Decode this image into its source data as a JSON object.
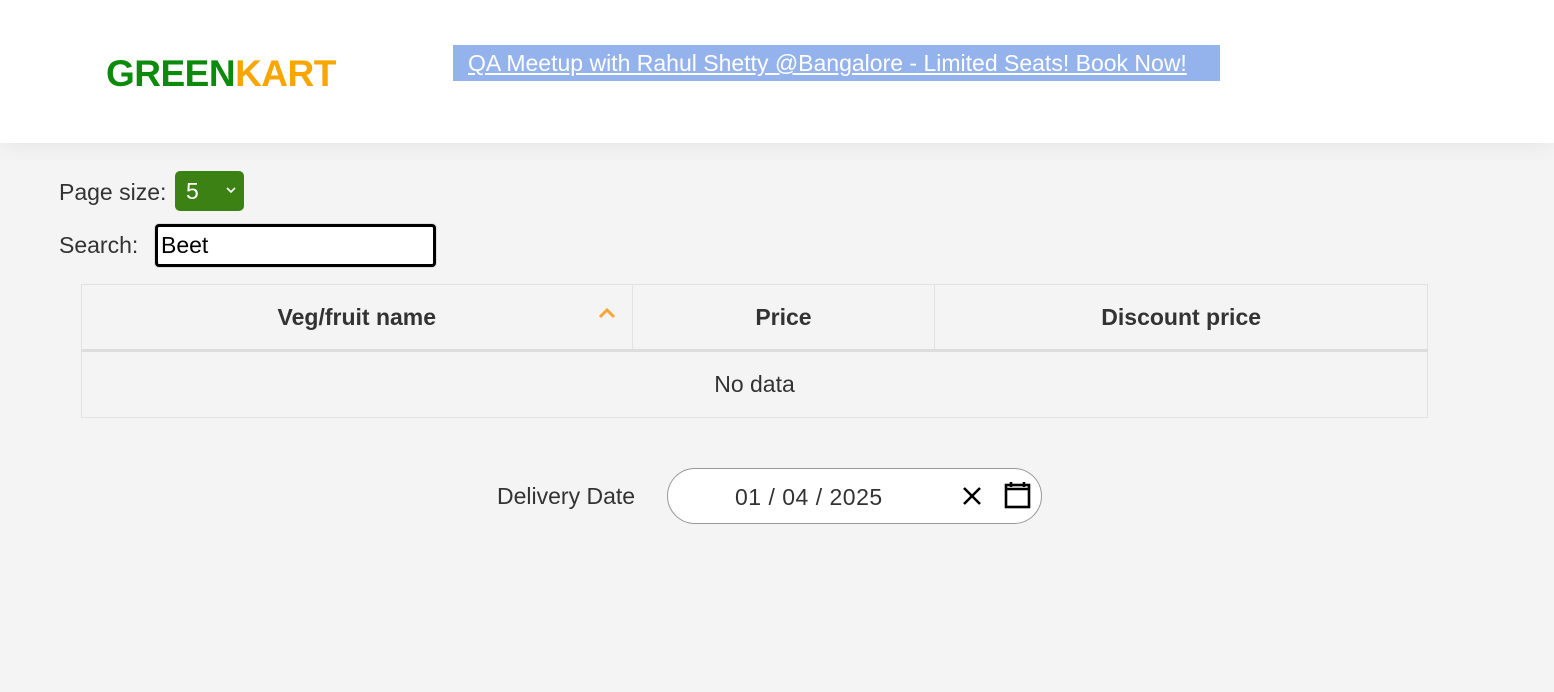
{
  "header": {
    "brand_part1": "GREEN",
    "brand_part2": "KART",
    "promo_text": "QA Meetup with Rahul Shetty @Bangalore - Limited Seats! Book Now!"
  },
  "controls": {
    "page_size_label": "Page size:",
    "page_size_value": "5",
    "search_label": "Search:",
    "search_value": "Beet"
  },
  "table": {
    "columns": [
      "Veg/fruit name",
      "Price",
      "Discount price"
    ],
    "sort_column": "Veg/fruit name",
    "sort_direction": "ascending",
    "empty_text": "No data"
  },
  "delivery": {
    "label": "Delivery Date",
    "date_value": "01 / 04 / 2025"
  },
  "colors": {
    "brand_green": "#0b8a0b",
    "brand_orange": "#f9a602",
    "promo_bg": "#94b3ec",
    "select_bg": "#3b8113",
    "page_bg": "#f4f4f4"
  }
}
